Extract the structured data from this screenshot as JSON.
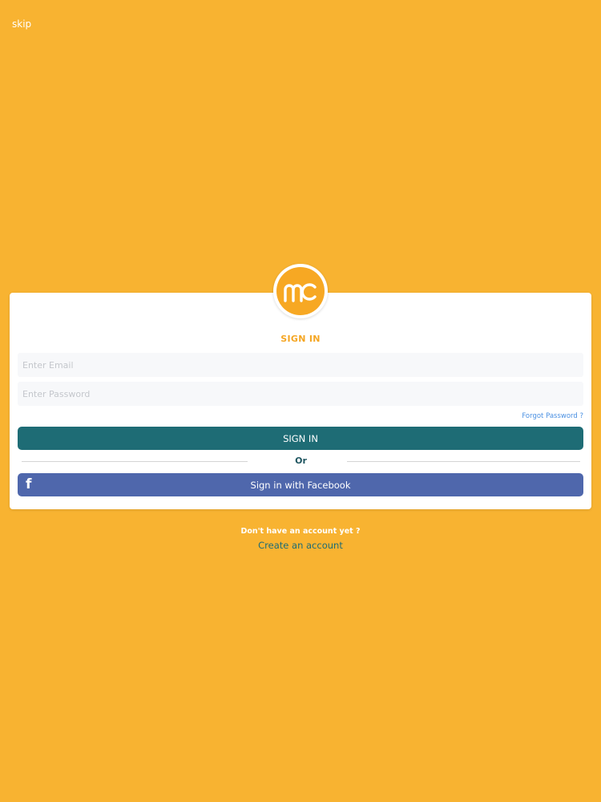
{
  "header": {
    "skip_label": "skip"
  },
  "logo": {
    "text": "mc",
    "icon": "mc-logo"
  },
  "form": {
    "title": "SIGN IN",
    "email_placeholder": "Enter Email",
    "password_placeholder": "Enter Password",
    "forgot_password_label": "Forgot Password ?",
    "signin_button_label": "SIGN IN",
    "divider_label": "Or",
    "facebook_button_label": "Sign in with Facebook",
    "facebook_icon": "facebook-f-icon"
  },
  "footer": {
    "no_account_text": "Don't have an account yet ?",
    "create_account_label": "Create an account"
  },
  "colors": {
    "background": "#F8B331",
    "accent": "#F5A623",
    "primary_button": "#1E6C75",
    "facebook_button": "#4F67AC",
    "link": "#4A90E2"
  }
}
